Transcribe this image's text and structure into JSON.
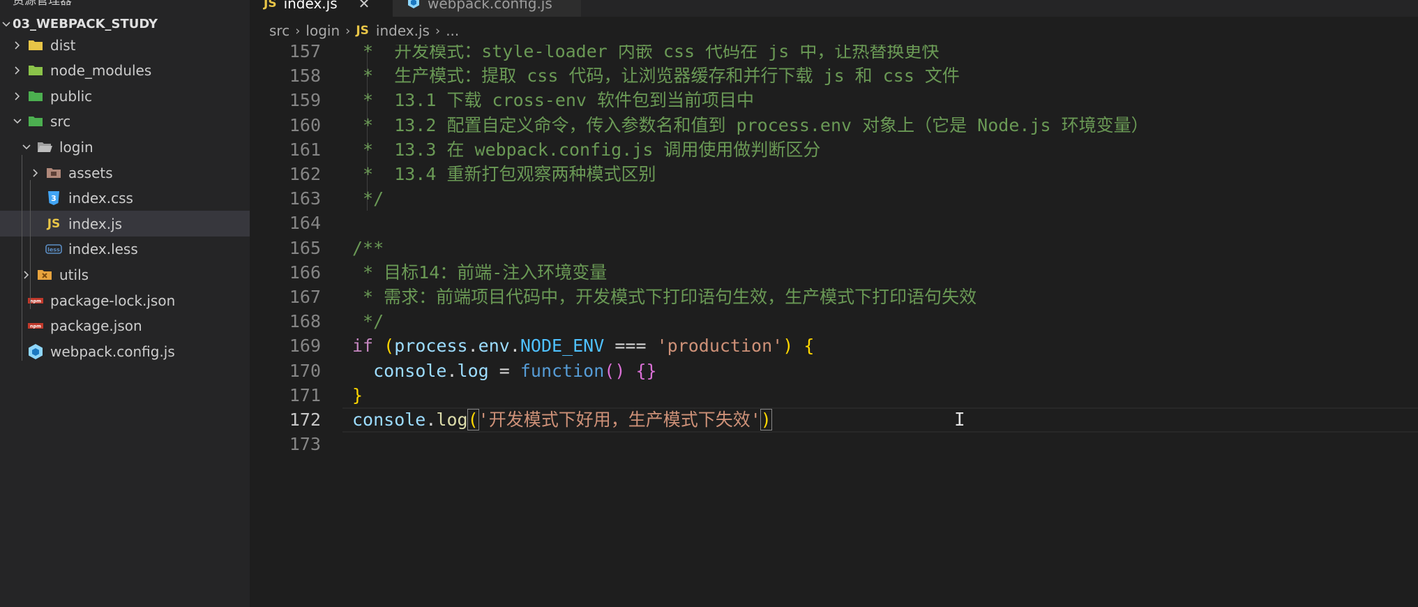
{
  "sidebar": {
    "title": "资源管理器",
    "project": "03_WEBPACK_STUDY",
    "items": [
      {
        "label": "dist",
        "kind": "folder",
        "icon": "folder-dist-icon",
        "color": "#e8c547",
        "expanded": false,
        "depth": 1
      },
      {
        "label": "node_modules",
        "kind": "folder",
        "icon": "folder-node-icon",
        "color": "#8bc34a",
        "expanded": false,
        "depth": 1
      },
      {
        "label": "public",
        "kind": "folder",
        "icon": "folder-public-icon",
        "color": "#4caf50",
        "expanded": false,
        "depth": 1
      },
      {
        "label": "src",
        "kind": "folder",
        "icon": "folder-src-icon",
        "color": "#4caf50",
        "expanded": true,
        "depth": 1
      },
      {
        "label": "login",
        "kind": "folder",
        "icon": "folder-open-icon",
        "color": "#9e9e9e",
        "expanded": true,
        "depth": 2
      },
      {
        "label": "assets",
        "kind": "folder",
        "icon": "folder-assets-icon",
        "color": "#b0887a",
        "expanded": false,
        "depth": 3
      },
      {
        "label": "index.css",
        "kind": "file",
        "icon": "css-file-icon",
        "color": "#42a5f5",
        "depth": 3
      },
      {
        "label": "index.js",
        "kind": "file",
        "icon": "js-file-icon",
        "color": "#e8c547",
        "depth": 3,
        "selected": true
      },
      {
        "label": "index.less",
        "kind": "file",
        "icon": "less-file-icon",
        "color": "#5c8ec4",
        "depth": 3
      },
      {
        "label": "utils",
        "kind": "folder",
        "icon": "folder-utils-icon",
        "color": "#e8a33d",
        "expanded": false,
        "depth": 2
      },
      {
        "label": "package-lock.json",
        "kind": "file",
        "icon": "npm-file-icon",
        "color": "#c0392b",
        "depth": 1
      },
      {
        "label": "package.json",
        "kind": "file",
        "icon": "npm-file-icon",
        "color": "#c0392b",
        "depth": 1
      },
      {
        "label": "webpack.config.js",
        "kind": "file",
        "icon": "webpack-file-icon",
        "color": "#8ed6fb",
        "depth": 1
      }
    ]
  },
  "tabs": [
    {
      "label": "index.js",
      "icon": "JS",
      "active": true
    },
    {
      "label": "webpack.config.js",
      "icon": "webpack-file-icon",
      "active": false
    }
  ],
  "breadcrumb": {
    "parts": [
      "src",
      "login"
    ],
    "file_badge": "JS",
    "file": "index.js",
    "tail": "..."
  },
  "editor": {
    "current_line": "172",
    "lines": [
      {
        "n": "157",
        "tokens": [
          {
            "t": " *  开发模式：style-loader 内嵌 css 代码在 js 中，让热替换更快",
            "c": "c-comment"
          }
        ]
      },
      {
        "n": "158",
        "tokens": [
          {
            "t": " *  生产模式：提取 css 代码，让浏览器缓存和并行下载 js 和 css 文件",
            "c": "c-comment"
          }
        ]
      },
      {
        "n": "159",
        "tokens": [
          {
            "t": " *  13.1 下载 cross-env 软件包到当前项目中",
            "c": "c-comment"
          }
        ]
      },
      {
        "n": "160",
        "tokens": [
          {
            "t": " *  13.2 配置自定义命令，传入参数名和值到 process.env 对象上（它是 Node.js 环境变量）",
            "c": "c-comment"
          }
        ]
      },
      {
        "n": "161",
        "tokens": [
          {
            "t": " *  13.3 在 webpack.config.js 调用使用做判断区分",
            "c": "c-comment"
          }
        ]
      },
      {
        "n": "162",
        "tokens": [
          {
            "t": " *  13.4 重新打包观察两种模式区别",
            "c": "c-comment"
          }
        ]
      },
      {
        "n": "163",
        "tokens": [
          {
            "t": " */",
            "c": "c-comment"
          }
        ]
      },
      {
        "n": "164",
        "tokens": []
      },
      {
        "n": "165",
        "tokens": [
          {
            "t": "/**",
            "c": "c-comment"
          }
        ]
      },
      {
        "n": "166",
        "tokens": [
          {
            "t": " * 目标14：前端-注入环境变量",
            "c": "c-comment"
          }
        ]
      },
      {
        "n": "167",
        "tokens": [
          {
            "t": " * 需求：前端项目代码中，开发模式下打印语句生效，生产模式下打印语句失效",
            "c": "c-comment"
          }
        ]
      },
      {
        "n": "168",
        "tokens": [
          {
            "t": " */",
            "c": "c-comment"
          }
        ]
      },
      {
        "n": "169",
        "tokens": [
          {
            "t": "if",
            "c": "c-keyword"
          },
          {
            "t": " ",
            "c": "c-plain"
          },
          {
            "t": "(",
            "c": "c-brace1"
          },
          {
            "t": "process",
            "c": "c-var"
          },
          {
            "t": ".",
            "c": "c-plain"
          },
          {
            "t": "env",
            "c": "c-var"
          },
          {
            "t": ".",
            "c": "c-plain"
          },
          {
            "t": "NODE_ENV",
            "c": "c-const"
          },
          {
            "t": " === ",
            "c": "c-plain"
          },
          {
            "t": "'production'",
            "c": "c-string"
          },
          {
            "t": ")",
            "c": "c-brace1"
          },
          {
            "t": " ",
            "c": "c-plain"
          },
          {
            "t": "{",
            "c": "c-brace1"
          }
        ]
      },
      {
        "n": "170",
        "tokens": [
          {
            "t": "  ",
            "c": "c-plain"
          },
          {
            "t": "console",
            "c": "c-var"
          },
          {
            "t": ".",
            "c": "c-plain"
          },
          {
            "t": "log",
            "c": "c-var"
          },
          {
            "t": " = ",
            "c": "c-plain"
          },
          {
            "t": "function",
            "c": "c-decl"
          },
          {
            "t": "()",
            "c": "c-brace2"
          },
          {
            "t": " ",
            "c": "c-plain"
          },
          {
            "t": "{}",
            "c": "c-brace2"
          }
        ]
      },
      {
        "n": "171",
        "tokens": [
          {
            "t": "}",
            "c": "c-brace1"
          }
        ]
      },
      {
        "n": "172",
        "tokens": [
          {
            "t": "console",
            "c": "c-var"
          },
          {
            "t": ".",
            "c": "c-plain"
          },
          {
            "t": "log",
            "c": "c-func"
          },
          {
            "t": "(",
            "c": "c-brace1 c-paren-match"
          },
          {
            "t": "'开发模式下好用，生产模式下失效'",
            "c": "c-string"
          },
          {
            "t": ")",
            "c": "c-brace1 c-paren-match"
          }
        ]
      },
      {
        "n": "173",
        "tokens": []
      }
    ]
  },
  "cursor_icon": "text-cursor-icon",
  "colors": {
    "editor_bg": "#1e1e1e",
    "sidebar_bg": "#252526",
    "comment": "#6a9955",
    "string": "#ce9178",
    "keyword": "#c586c0"
  }
}
